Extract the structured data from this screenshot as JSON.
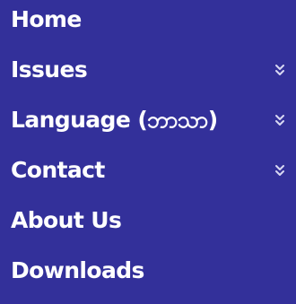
{
  "menu": {
    "items": [
      {
        "label": "Home",
        "has_submenu": false
      },
      {
        "label": "Issues",
        "has_submenu": true
      },
      {
        "label": "Language (ဘာသာ)",
        "has_submenu": true
      },
      {
        "label": "Contact",
        "has_submenu": true
      },
      {
        "label": "About Us",
        "has_submenu": false
      },
      {
        "label": "Downloads",
        "has_submenu": false
      }
    ]
  },
  "icons": {
    "submenu": "double-chevron-down-icon"
  },
  "colors": {
    "background": "#33309a",
    "text": "#ffffff",
    "chevron": "#d8d8f2"
  }
}
